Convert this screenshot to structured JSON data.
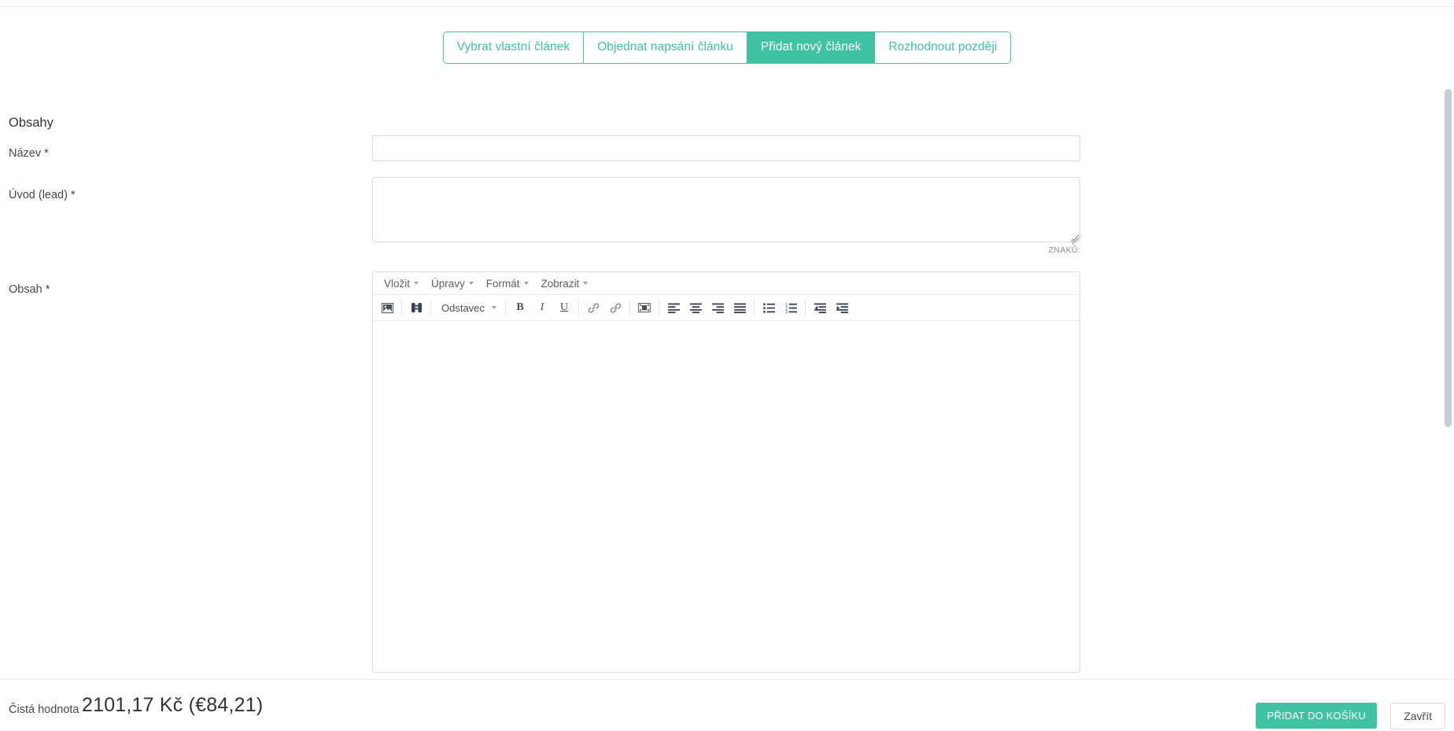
{
  "tabs": [
    {
      "label": "Vybrat vlastní článek",
      "active": false
    },
    {
      "label": "Objednat napsání článku",
      "active": false
    },
    {
      "label": "Přidat nový článek",
      "active": true
    },
    {
      "label": "Rozhodnout později",
      "active": false
    }
  ],
  "form": {
    "section_title": "Obsahy",
    "title_label": "Název *",
    "title_value": "",
    "title_placeholder": "",
    "lead_label": "Úvod (lead) *",
    "lead_value": "",
    "lead_placeholder": "",
    "char_count_label": "ZNAKŮ:",
    "content_label": "Obsah *"
  },
  "editor": {
    "menus": [
      {
        "label": "Vložit",
        "icon": "chevron-down-icon"
      },
      {
        "label": "Úpravy",
        "icon": "chevron-down-icon"
      },
      {
        "label": "Formát",
        "icon": "chevron-down-icon"
      },
      {
        "label": "Zobrazit",
        "icon": "chevron-down-icon"
      }
    ],
    "format_select": "Odstavec",
    "toolbar": [
      {
        "name": "insert-image-icon",
        "title": "Vložit obrázek"
      },
      {
        "name": "find-replace-icon",
        "title": "Najít a nahradit"
      },
      {
        "name": "bold-icon",
        "title": "Tučné",
        "glyph": "B"
      },
      {
        "name": "italic-icon",
        "title": "Kurzíva",
        "glyph": "I"
      },
      {
        "name": "underline-icon",
        "title": "Podtržené",
        "glyph": "U"
      },
      {
        "name": "link-icon",
        "title": "Vložit odkaz"
      },
      {
        "name": "unlink-icon",
        "title": "Odstranit odkaz"
      },
      {
        "name": "media-icon",
        "title": "Vložit média"
      },
      {
        "name": "align-left-icon",
        "title": "Zarovnat vlevo"
      },
      {
        "name": "align-center-icon",
        "title": "Zarovnat na střed"
      },
      {
        "name": "align-right-icon",
        "title": "Zarovnat vpravo"
      },
      {
        "name": "align-justify-icon",
        "title": "Do bloku"
      },
      {
        "name": "bullet-list-icon",
        "title": "Odrážky"
      },
      {
        "name": "numbered-list-icon",
        "title": "Číslovaný seznam"
      },
      {
        "name": "outdent-icon",
        "title": "Zmenšit odsazení"
      },
      {
        "name": "indent-icon",
        "title": "Zvětšit odsazení"
      }
    ],
    "content": ""
  },
  "footer": {
    "net_label": "Čistá hodnota",
    "net_value": "2101,17 Kč (€84,21)",
    "add_to_cart": "PŘIDAT DO KOŠÍKU",
    "close": "Zavřít"
  },
  "colors": {
    "accent": "#3fc3a2",
    "border": "#d7dbe0",
    "text": "#45484d",
    "muted": "#8a8f96"
  }
}
